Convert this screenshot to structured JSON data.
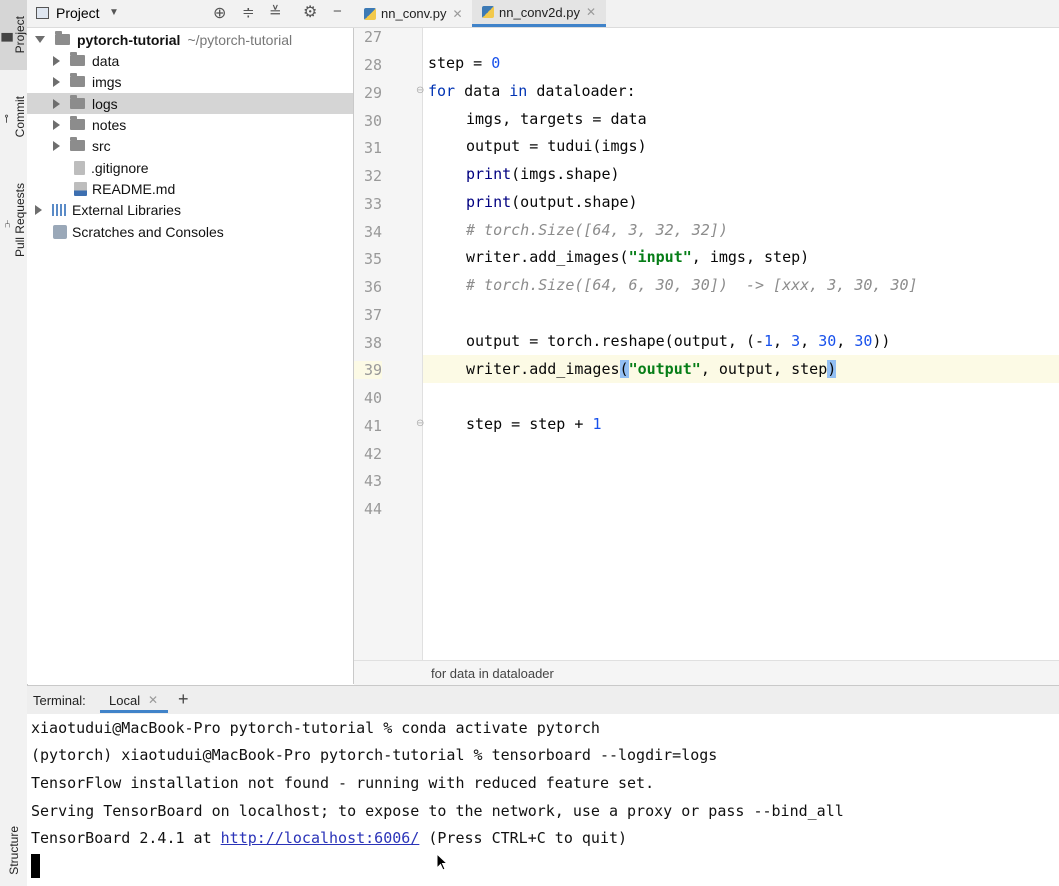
{
  "tool_strip": {
    "project": "Project",
    "commit": "Commit",
    "pull_requests": "Pull Requests",
    "structure": "Structure"
  },
  "project_panel": {
    "title": "Project",
    "root": {
      "name": "pytorch-tutorial",
      "path": "~/pytorch-tutorial"
    },
    "items": [
      {
        "label": "data"
      },
      {
        "label": "imgs"
      },
      {
        "label": "logs"
      },
      {
        "label": "notes"
      },
      {
        "label": "src"
      },
      {
        "label": ".gitignore"
      },
      {
        "label": "README.md"
      }
    ],
    "external_libraries": "External Libraries",
    "scratches": "Scratches and Consoles"
  },
  "tabs": [
    {
      "label": "nn_conv.py",
      "active": false
    },
    {
      "label": "nn_conv2d.py",
      "active": true
    }
  ],
  "editor": {
    "line_numbers": [
      "27",
      "28",
      "29",
      "30",
      "31",
      "32",
      "33",
      "34",
      "35",
      "36",
      "37",
      "38",
      "39",
      "40",
      "41",
      "42",
      "43",
      "44"
    ],
    "current_line": "39",
    "breadcrumb": "for data in dataloader",
    "code": {
      "l28": {
        "a": "step = ",
        "b": "0"
      },
      "l29": {
        "a": "for",
        "b": " data ",
        "c": "in",
        "d": " dataloader:"
      },
      "l30": "imgs, targets = data",
      "l31": "output = tudui(imgs)",
      "l32": {
        "a": "print",
        "b": "(imgs.shape)"
      },
      "l33": {
        "a": "print",
        "b": "(output.shape)"
      },
      "l34": "# torch.Size([64, 3, 32, 32])",
      "l35": {
        "a": "writer.add_images(",
        "b": "\"input\"",
        "c": ", imgs, step)"
      },
      "l36": "# torch.Size([64, 6, 30, 30])  -> [xxx, 3, 30, 30]",
      "l38": {
        "a": "output = torch.reshape(output, (-",
        "b": "1",
        "c": ", ",
        "d": "3",
        "e": ", ",
        "f": "30",
        "g": ", ",
        "h": "30",
        "i": "))"
      },
      "l39": {
        "a": "writer.add_images",
        "b": "(",
        "c": "\"output\"",
        "d": ", output, step",
        "e": ")"
      },
      "l41": {
        "a": "step = step + ",
        "b": "1"
      }
    }
  },
  "terminal": {
    "label": "Terminal:",
    "tab": "Local",
    "add": "+",
    "lines": [
      "xiaotudui@MacBook-Pro pytorch-tutorial % conda activate pytorch",
      "(pytorch) xiaotudui@MacBook-Pro pytorch-tutorial % tensorboard --logdir=logs",
      "TensorFlow installation not found - running with reduced feature set.",
      "Serving TensorBoard on localhost; to expose to the network, use a proxy or pass --bind_all"
    ],
    "last_line": {
      "prefix": "TensorBoard 2.4.1 at ",
      "link": "http://localhost:6006/",
      "suffix": " (Press CTRL+C to quit)"
    }
  },
  "icons": {
    "locate": "crosshair-icon",
    "expand": "expand-all-icon",
    "collapse": "collapse-all-icon",
    "settings": "gear-icon",
    "hide": "minimize-icon"
  }
}
